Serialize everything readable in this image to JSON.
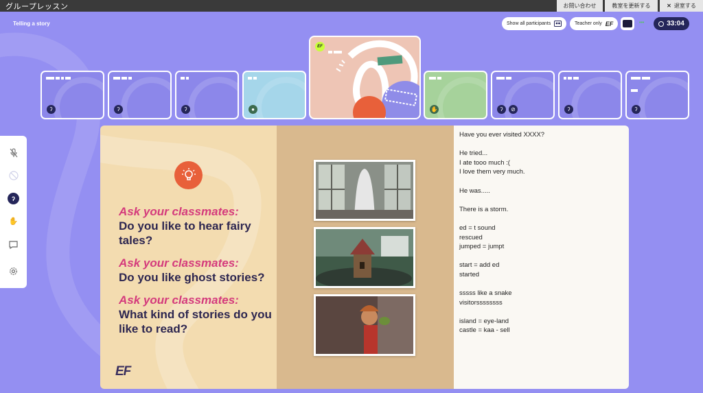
{
  "window": {
    "title": "グループレッスン"
  },
  "topbar": {
    "contact_label": "お問い合わせ",
    "refresh_label": "教室を更新する",
    "leave_label": "退室する"
  },
  "lesson": {
    "title": "Telling a story"
  },
  "header": {
    "show_all_label": "Show all participants",
    "teacher_only_label": "Teacher only",
    "teacher_only_badge": "EF",
    "indicator": "•••",
    "timer": "33:04"
  },
  "teacher_tile": {
    "badge": "EF"
  },
  "slide": {
    "prompts": [
      {
        "ask": "Ask your classmates:",
        "question": "Do you like to hear fairy tales?"
      },
      {
        "ask": "Ask your classmates:",
        "question": "Do you like ghost stories?"
      },
      {
        "ask": "Ask your classmates:",
        "question": "What kind of stories do you like to read?"
      }
    ],
    "logo": "EF"
  },
  "notes": {
    "lines": [
      "Have you ever visited XXXX?",
      "",
      "He tried...",
      "I ate tooo much :(",
      "I love them very much.",
      "",
      "He was.....",
      "",
      "There is a storm.",
      "",
      "ed = t sound",
      "rescued",
      "jumped = jumpt",
      "",
      "start = add ed",
      "started",
      "",
      "sssss like a snake",
      "visitorssssssss",
      "",
      "island = eye-land",
      "castle = kaa - sell"
    ]
  },
  "colors": {
    "background": "#948ff2",
    "accent_pink": "#d43a7c",
    "navy": "#25265a",
    "bulb_orange": "#e8603a"
  }
}
